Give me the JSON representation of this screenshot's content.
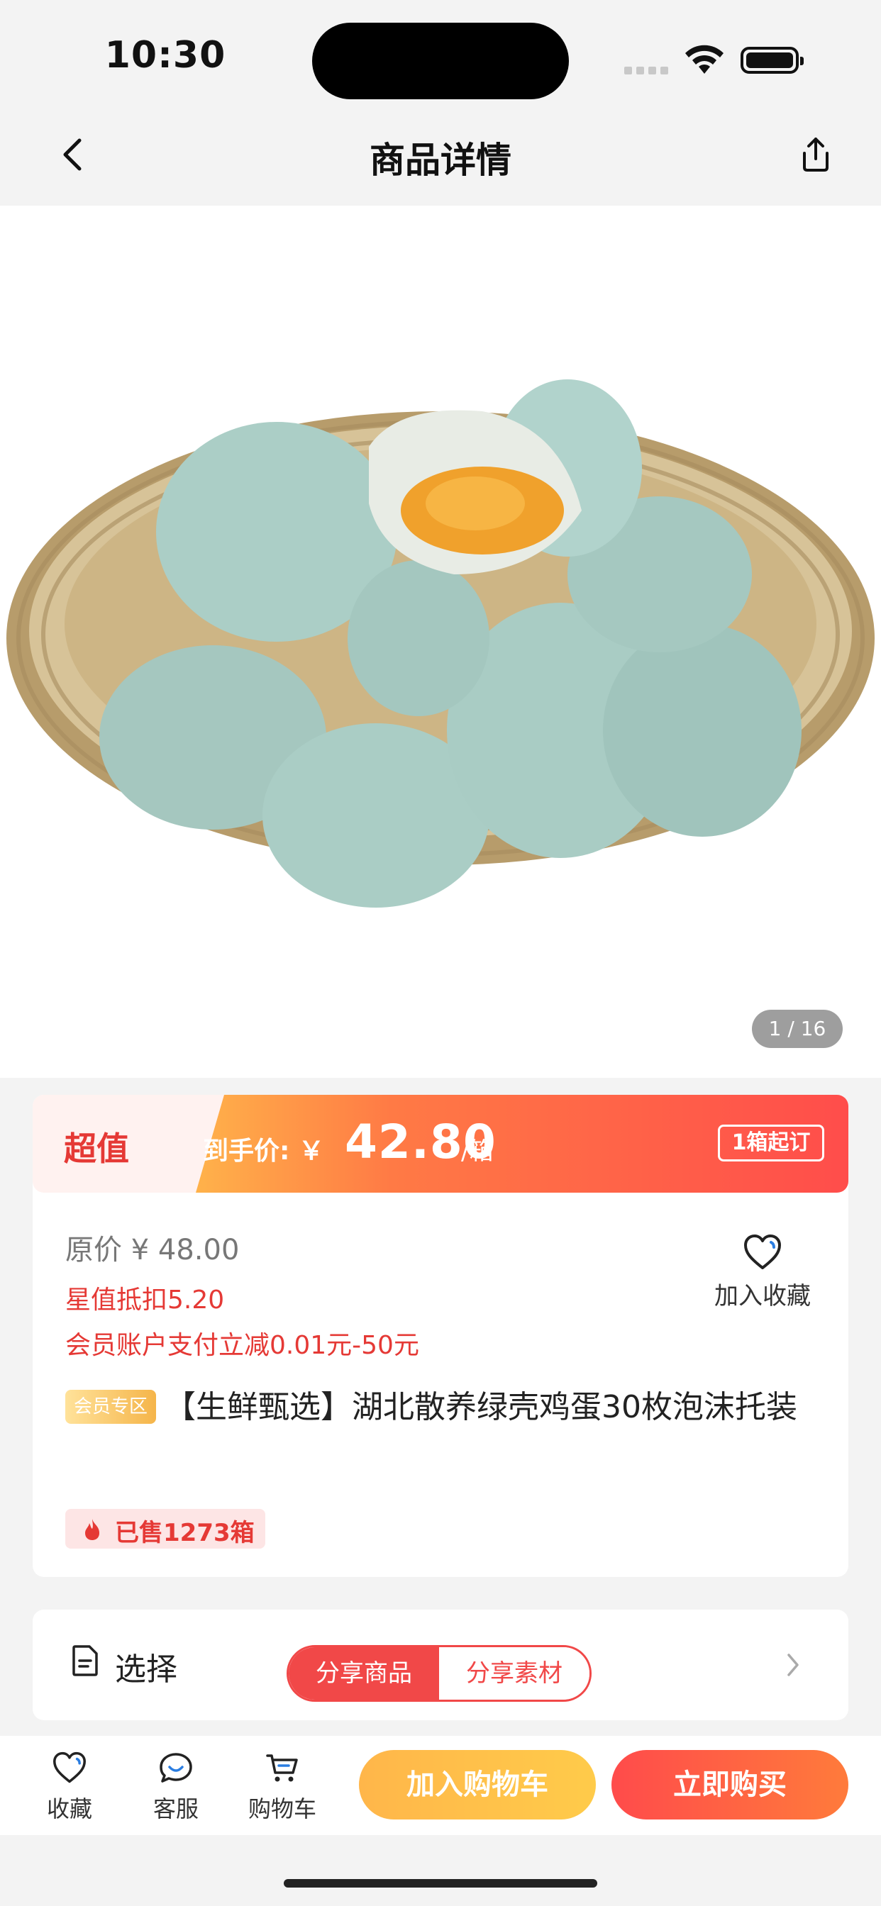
{
  "status_bar": {
    "time": "10:30"
  },
  "nav": {
    "title": "商品详情",
    "back_icon": "chevron-left-icon",
    "share_icon": "share-icon"
  },
  "gallery": {
    "counter": "1 / 16"
  },
  "price": {
    "badge": "超值",
    "label": "到手价: ￥",
    "value": "42.80",
    "unit": "/箱",
    "min_order": "1箱起订",
    "original": "原价 ¥ 48.00",
    "discount_star": "星值抵扣5.20",
    "discount_member": "会员账户支付立减0.01元-50元"
  },
  "favorite": {
    "label": "加入收藏",
    "icon": "heart-icon"
  },
  "product": {
    "member_tag": "会员专区",
    "title": "【生鲜甄选】湖北散养绿壳鸡蛋30枚泡沫托装",
    "sold": "已售1273箱"
  },
  "select": {
    "label": "选择",
    "share_goods": "分享商品",
    "share_material": "分享素材"
  },
  "bottom_bar": {
    "tabs": [
      {
        "label": "收藏",
        "icon": "heart-icon"
      },
      {
        "label": "客服",
        "icon": "chat-icon"
      },
      {
        "label": "购物车",
        "icon": "cart-icon"
      }
    ],
    "add_to_cart": "加入购物车",
    "buy_now": "立即购买"
  },
  "colors": {
    "accent_red": "#f14848",
    "banner_orange": "#ff7a45",
    "cart_yellow": "#ffc04a"
  }
}
